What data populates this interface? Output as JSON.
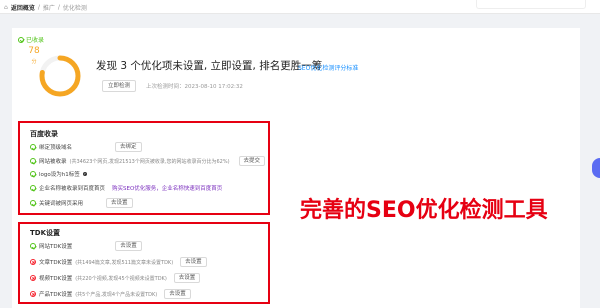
{
  "breadcrumb": {
    "home": "返回概览",
    "level1": "推广",
    "level2": "优化检测"
  },
  "summary": {
    "status": "已收录",
    "score": "78",
    "score_unit": "分",
    "score_fraction": 0.78,
    "headline": "发现 3 个优化项未设置, 立即设置, 排名更胜一筹",
    "standard_link": "SEO优化检测评分标准",
    "detect_button": "立即检测",
    "last_detect_label": "上次检测时间：2023-08-10 17:02:32"
  },
  "baidu_section": {
    "title": "百度收录",
    "rows": [
      {
        "label": "绑定顶级域名",
        "button": "去绑定",
        "state": "ok"
      },
      {
        "label": "网站被收录",
        "note": "(共34623个网页,发现21513个网页被收录,您的网站收录百分比为62%)",
        "button": "去提交",
        "state": "ok"
      },
      {
        "label": "logo设为h1标签",
        "state": "ok"
      },
      {
        "label": "企业名称被收录到百度首页",
        "link": "购买SEO优化服务，企业名称快速到百度首页",
        "state": "ok"
      },
      {
        "label": "关键词被网页采用",
        "button": "去设置",
        "state": "ok"
      }
    ]
  },
  "tdk_section": {
    "title": "TDK设置",
    "rows": [
      {
        "label": "网站TDK设置",
        "button": "去设置",
        "state": "ok"
      },
      {
        "label": "文章TDK设置",
        "note": "(共1494篇文章,发现511篇文章未设置TDK)",
        "button": "去设置",
        "state": "error"
      },
      {
        "label": "视频TDK设置",
        "note": "(共220个视频,发现45个视频未设置TDK)",
        "button": "去设置",
        "state": "error"
      },
      {
        "label": "产品TDK设置",
        "note": "(共5个产品,发现4个产品未设置TDK)",
        "button": "去设置",
        "state": "error"
      }
    ]
  },
  "overlay_text": "完善的SEO优化检测工具",
  "colors": {
    "accent": "#1890ff",
    "highlight": "#e60012",
    "ok": "#52c41a",
    "gauge": "#f5a623"
  }
}
